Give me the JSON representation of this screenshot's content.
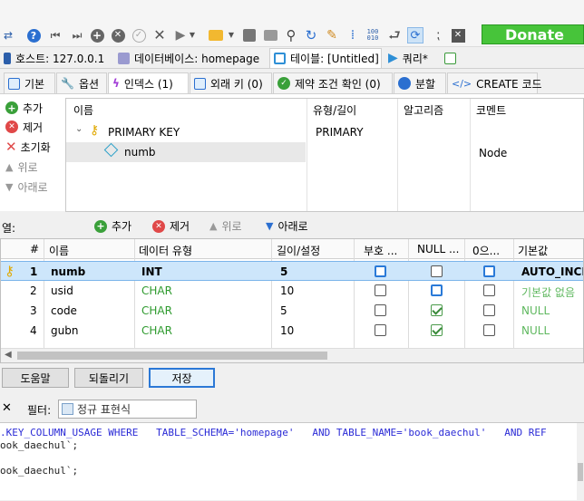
{
  "toolbar": {
    "donate_label": "Donate",
    "icons": [
      "swap-icon",
      "help-icon",
      "first-icon",
      "last-icon",
      "add-icon",
      "delete-icon",
      "apply-icon",
      "cancel-icon",
      "run-icon",
      "run-dropdown",
      "open-folder-icon",
      "save-icon",
      "print-icon",
      "find-icon",
      "refresh-icon",
      "clean-icon",
      "binary-icon",
      "wrap-icon",
      "format-icon",
      "comment-icon",
      "close-tab-icon"
    ]
  },
  "session_tabs": [
    {
      "label": "호스트: 127.0.0.1",
      "color": "#2b5eaa"
    },
    {
      "label": "데이터베이스: homepage",
      "color": "#9a9ad0"
    },
    {
      "label": "테이블: [Untitled]",
      "color": "#2e8fd6"
    },
    {
      "label": "쿼리*",
      "color": "#2e8fd6"
    }
  ],
  "sub_tabs": [
    {
      "label": "기본"
    },
    {
      "label": "옵션"
    },
    {
      "label": "인덱스 (1)"
    },
    {
      "label": "외래 키 (0)"
    },
    {
      "label": "제약 조건 확인 (0)"
    },
    {
      "label": "분할"
    },
    {
      "label": "CREATE 코드"
    }
  ],
  "index_panel": {
    "buttons": {
      "add": "추가",
      "remove": "제거",
      "reset": "초기화",
      "up": "위로",
      "down": "아래로"
    },
    "headers": {
      "name": "이름",
      "type": "유형/길이",
      "algorithm": "알고리즘",
      "comment": "코멘트"
    },
    "key_name": "PRIMARY KEY",
    "key_type": "PRIMARY",
    "field_name": "numb",
    "field_comment": "Node"
  },
  "columns_bar": {
    "label": "열:",
    "add": "추가",
    "remove": "제거",
    "up": "위로",
    "down": "아래로"
  },
  "grid": {
    "headers": [
      "#",
      "이름",
      "데이터 유형",
      "길이/설정",
      "부호 ...",
      "NULL ...",
      "0으...",
      "기본값"
    ],
    "rows": [
      {
        "num": "1",
        "name": "numb",
        "type": "INT",
        "length": "5",
        "unsigned": false,
        "null": false,
        "zerofill": false,
        "default": "AUTO_INCREMENT",
        "selected": true
      },
      {
        "num": "2",
        "name": "usid",
        "type": "CHAR",
        "length": "10",
        "unsigned": false,
        "null": false,
        "zerofill": false,
        "default": "기본값 없음",
        "selected": false
      },
      {
        "num": "3",
        "name": "code",
        "type": "CHAR",
        "length": "5",
        "unsigned": false,
        "null": true,
        "zerofill": false,
        "default": "NULL",
        "selected": false
      },
      {
        "num": "4",
        "name": "gubn",
        "type": "CHAR",
        "length": "10",
        "unsigned": false,
        "null": true,
        "zerofill": false,
        "default": "NULL",
        "selected": false
      }
    ]
  },
  "bottom_buttons": {
    "help": "도움말",
    "revert": "되돌리기",
    "save": "저장"
  },
  "filter": {
    "close": "✕",
    "label": "필터:",
    "placeholder": "정규 표현식"
  },
  "sql": {
    "line1": ".KEY_COLUMN_USAGE WHERE   TABLE_SCHEMA='homepage'   AND TABLE_NAME='book_daechul'   AND REF",
    "line2": "ook_daechul`;",
    "line3": "ook_daechul`;"
  }
}
